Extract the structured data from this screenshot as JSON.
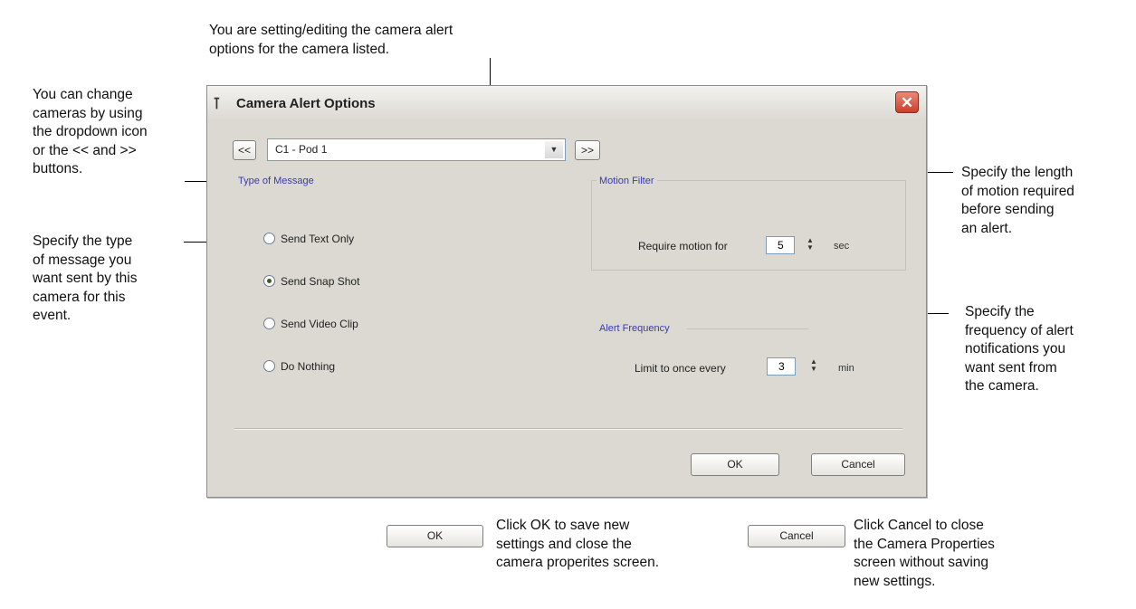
{
  "annotations": {
    "top": "You are setting/editing the camera alert\noptions for the camera listed.",
    "left_cameras": "You can change\ncameras by using\nthe dropdown icon\nor the << and >>\nbuttons.",
    "left_message": "Specify the type\nof message you\nwant sent by this\ncamera for this\nevent.",
    "right_motion": "Specify the length\nof motion required\nbefore sending\nan alert.",
    "right_frequency": "Specify the\nfrequency of alert\nnotifications you\nwant sent from\nthe camera.",
    "bottom_ok": "Click OK to save new\nsettings and close the\ncamera properites screen.",
    "bottom_cancel": "Click Cancel to close\nthe Camera Properties\nscreen without saving\nnew settings."
  },
  "dialog": {
    "title": "Camera Alert Options",
    "close_glyph": "✕",
    "prev_label": "<<",
    "next_label": ">>",
    "camera_value": "C1 - Pod 1",
    "message_group": {
      "label": "Type of Message",
      "options": [
        {
          "label": "Send Text Only",
          "selected": false
        },
        {
          "label": "Send Snap Shot",
          "selected": true
        },
        {
          "label": "Send Video Clip",
          "selected": false
        },
        {
          "label": "Do Nothing",
          "selected": false
        }
      ]
    },
    "motion_group": {
      "label": "Motion Filter",
      "field_label": "Require motion for",
      "value": "5",
      "unit": "sec"
    },
    "frequency_group": {
      "label": "Alert Frequency",
      "field_label": "Limit to once every",
      "value": "3",
      "unit": "min"
    },
    "ok_label": "OK",
    "cancel_label": "Cancel"
  },
  "legend_buttons": {
    "ok_label": "OK",
    "cancel_label": "Cancel"
  },
  "icons": {
    "title_icon": "camera-alert-icon",
    "close_icon": "close-icon",
    "dropdown_icon": "chevron-down-icon"
  },
  "colors": {
    "dialog_bg": "#dcd9d3",
    "group_label": "#3a3ab0",
    "close_button": "#c9402c"
  }
}
